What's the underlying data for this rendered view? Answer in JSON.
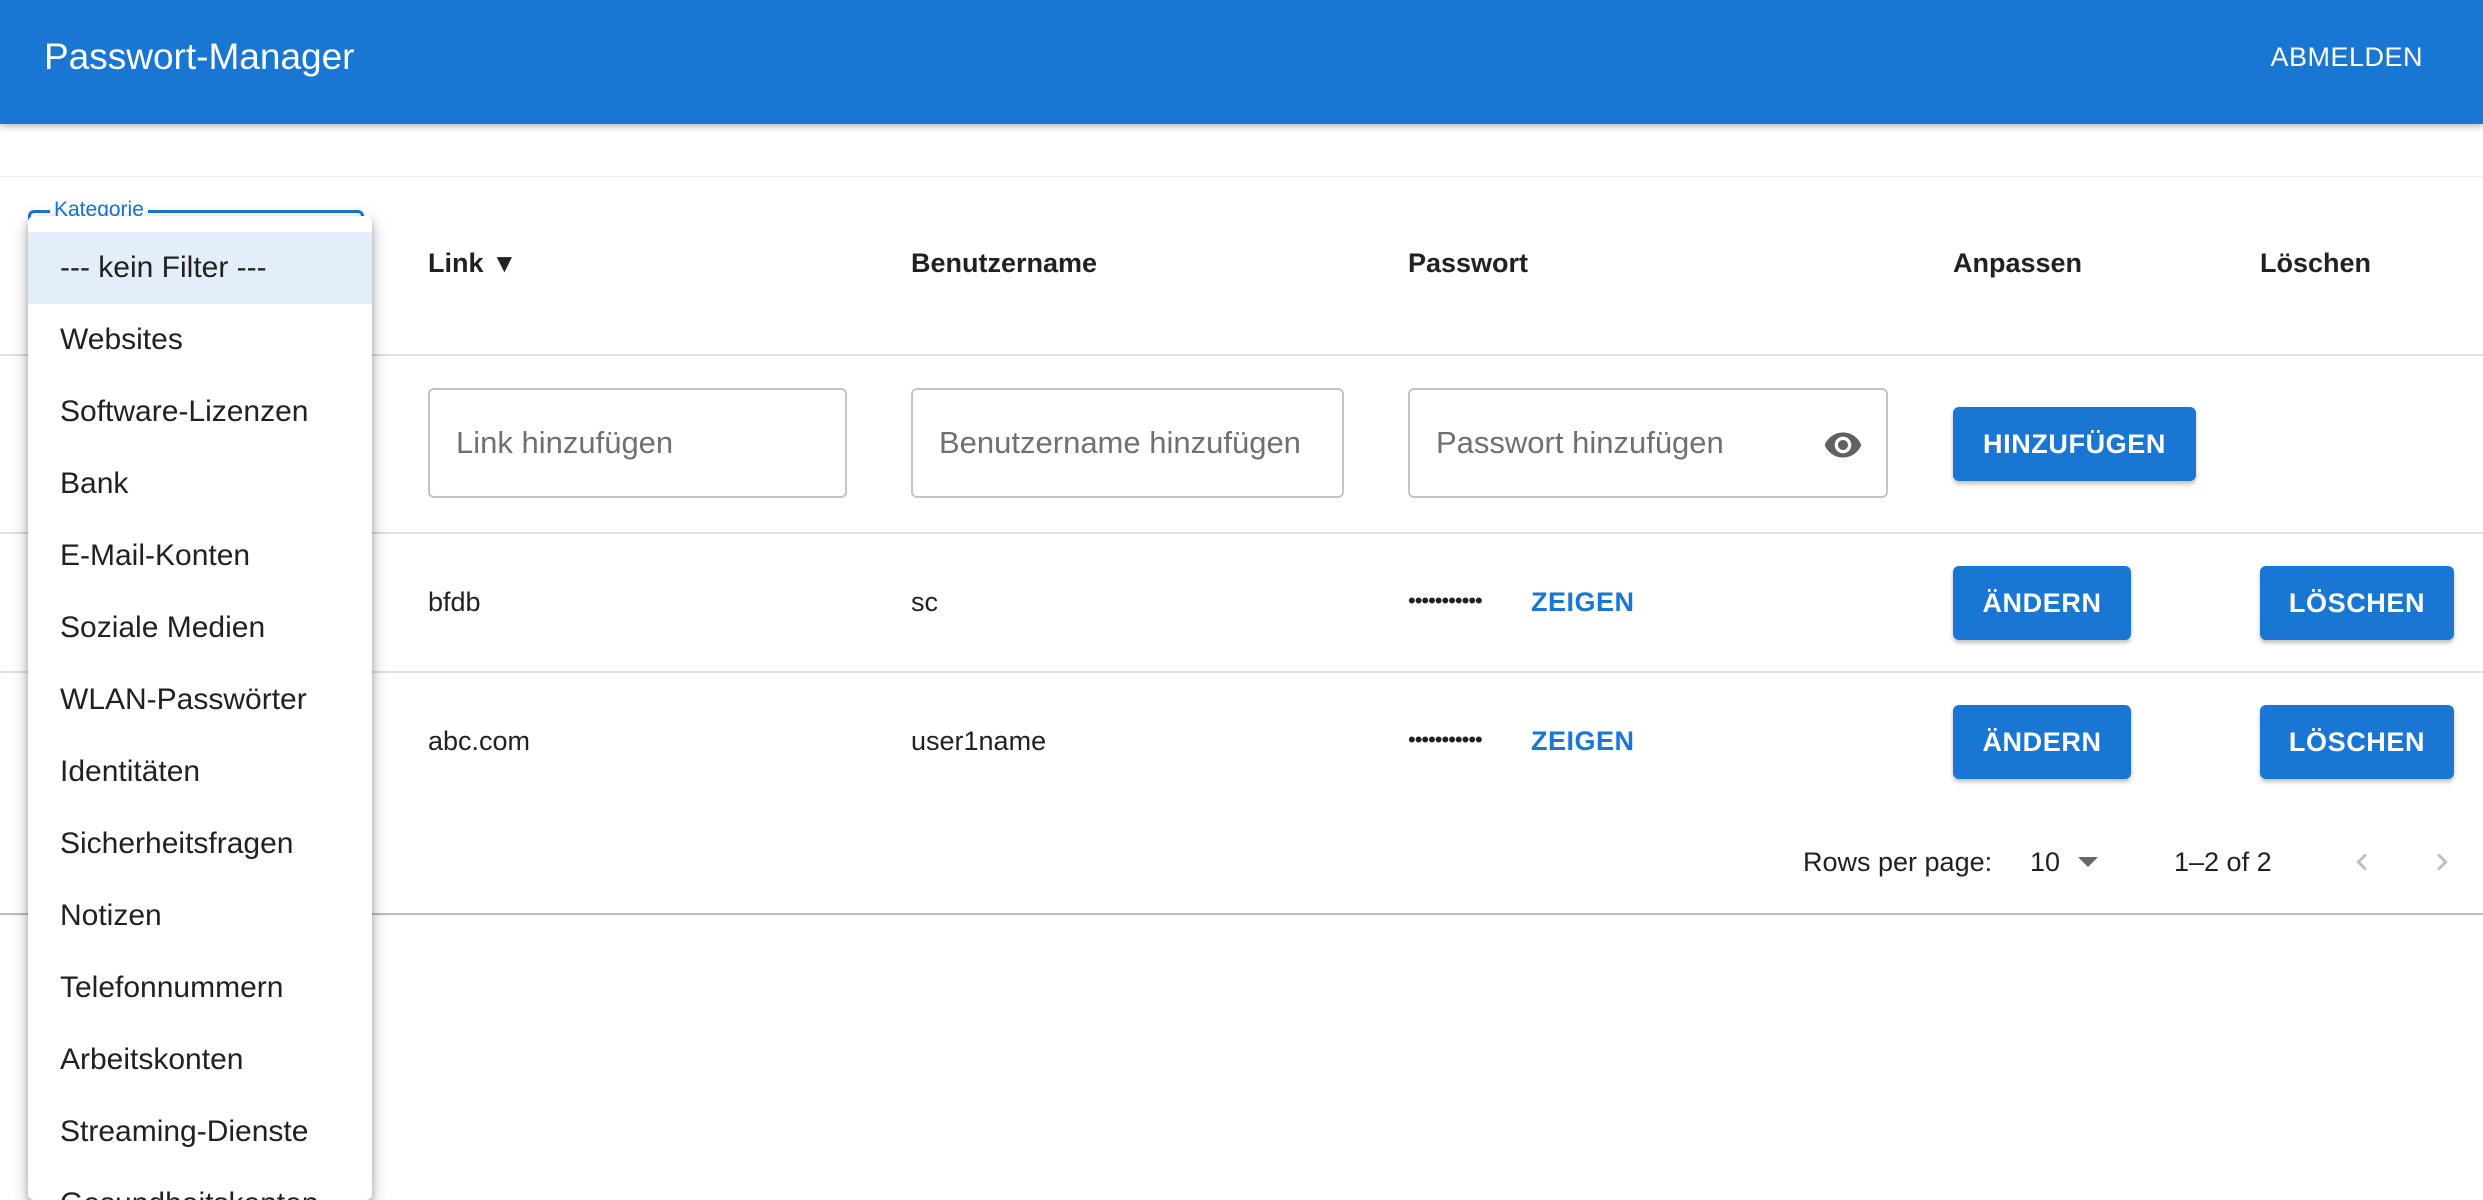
{
  "app": {
    "title": "Passwort-Manager",
    "logout_label": "ABMELDEN"
  },
  "category_select": {
    "label": "Kategorie",
    "options": [
      "--- kein Filter ---",
      "Websites",
      "Software-Lizenzen",
      "Bank",
      "E-Mail-Konten",
      "Soziale Medien",
      "WLAN-Passwörter",
      "Identitäten",
      "Sicherheitsfragen",
      "Notizen",
      "Telefonnummern",
      "Arbeitskonten",
      "Streaming-Dienste",
      "Gesundheitskonten"
    ],
    "selected": "--- kein Filter ---"
  },
  "table": {
    "headers": {
      "link": "Link",
      "link_sort": "▼",
      "username": "Benutzername",
      "password": "Passwort",
      "edit": "Anpassen",
      "delete": "Löschen"
    },
    "add_row": {
      "link_placeholder": "Link hinzufügen",
      "username_placeholder": "Benutzername hinzufügen",
      "password_placeholder": "Passwort hinzufügen",
      "add_label": "HINZUFÜGEN"
    },
    "rows": [
      {
        "link": "bfdb",
        "username": "sc",
        "password_mask": "•••••••••••",
        "show_label": "ZEIGEN",
        "edit_label": "ÄNDERN",
        "delete_label": "LÖSCHEN"
      },
      {
        "link": "abc.com",
        "username": "user1name",
        "password_mask": "•••••••••••",
        "show_label": "ZEIGEN",
        "edit_label": "ÄNDERN",
        "delete_label": "LÖSCHEN"
      }
    ]
  },
  "pagination": {
    "rows_per_page_label": "Rows per page:",
    "rows_per_page_value": "10",
    "range_text": "1–2 of 2"
  },
  "colors": {
    "primary": "#1976d2",
    "selected_option_bg": "#e3eefa"
  },
  "icons": {
    "visibility": "eye-icon",
    "dropdown": "caret-down-icon",
    "prev": "chevron-left-icon",
    "next": "chevron-right-icon"
  }
}
